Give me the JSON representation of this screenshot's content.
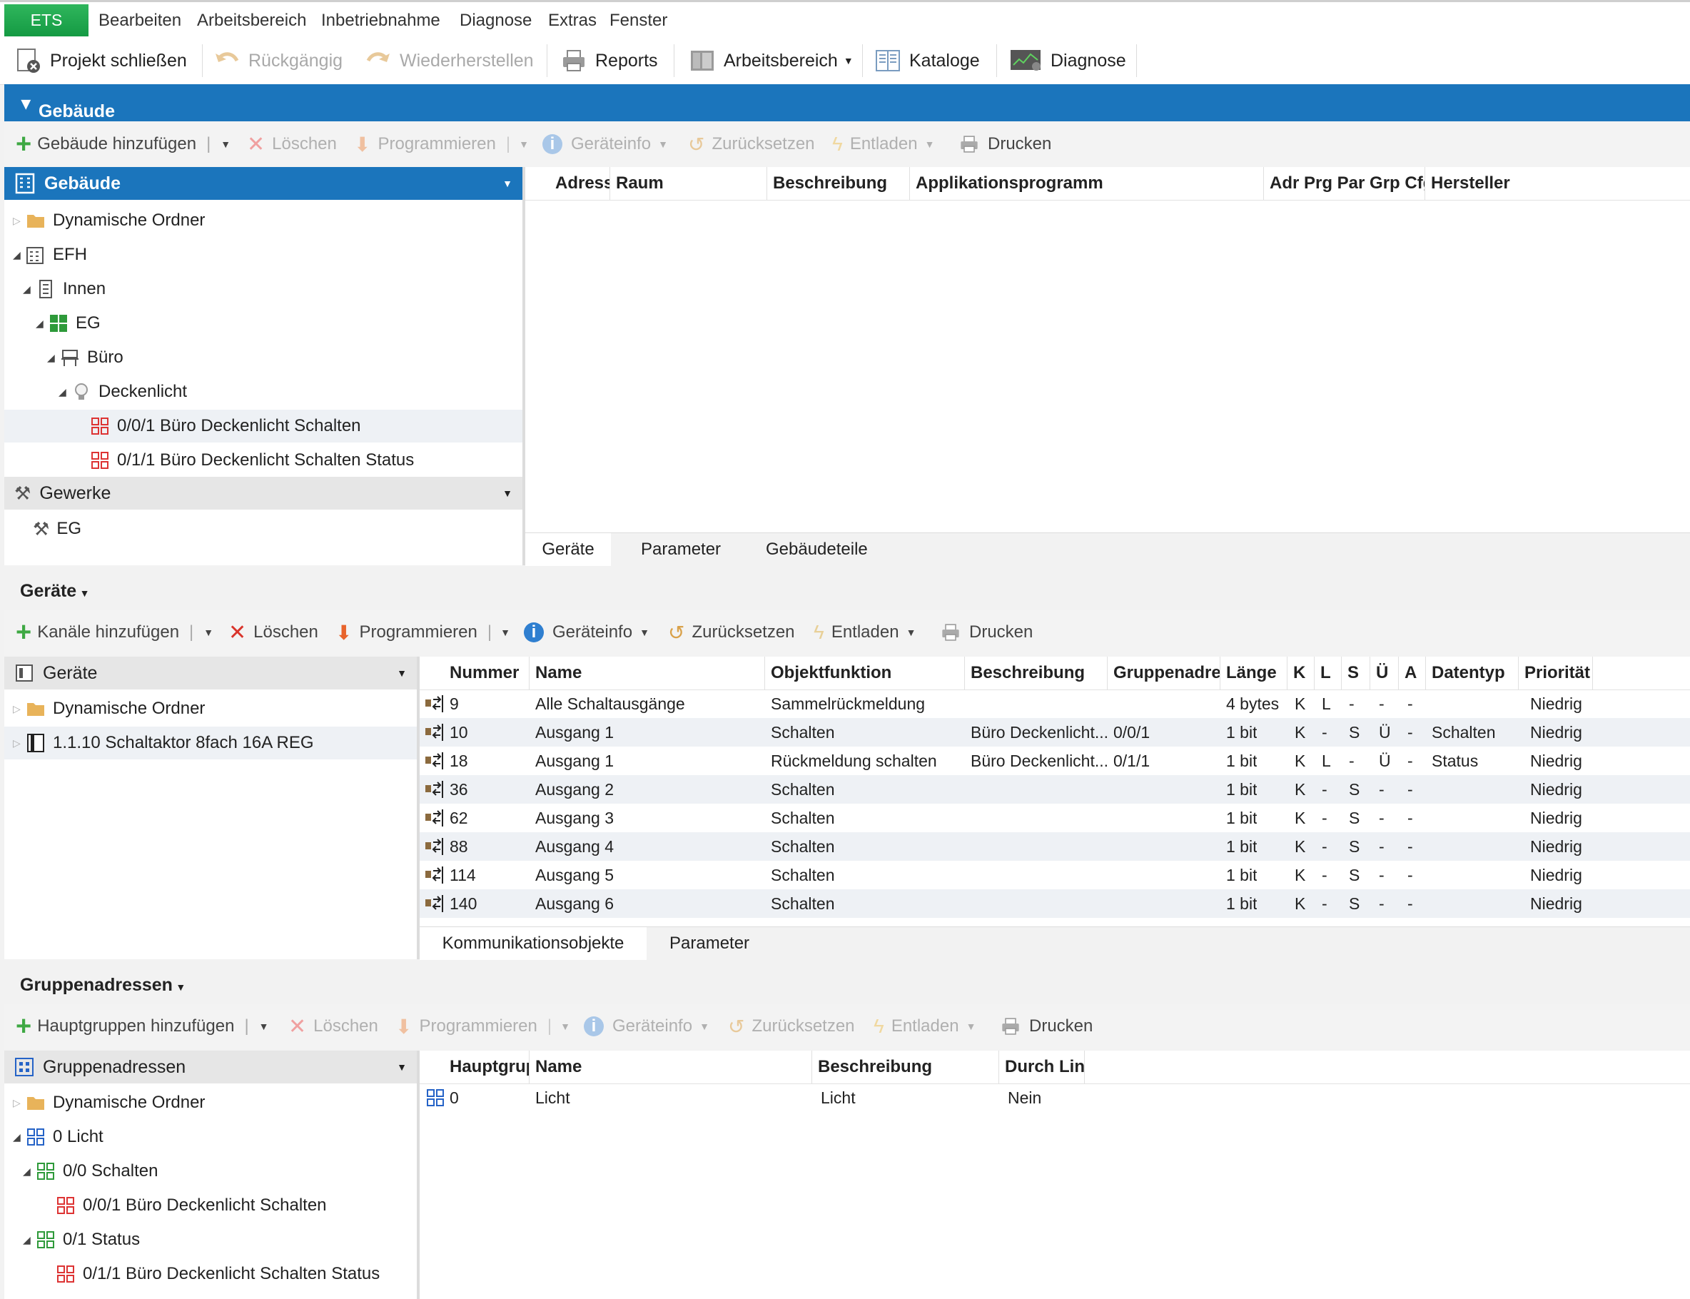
{
  "menu": {
    "ets": "ETS",
    "items": [
      "Bearbeiten",
      "Arbeitsbereich",
      "Inbetriebnahme",
      "Diagnose",
      "Extras",
      "Fenster"
    ]
  },
  "toolbar": {
    "close_project": "Projekt schließen",
    "undo": "Rückgängig",
    "redo": "Wiederherstellen",
    "reports": "Reports",
    "workspace": "Arbeitsbereich",
    "catalogs": "Kataloge",
    "diagnose": "Diagnose"
  },
  "building_bar": {
    "title": "Gebäude"
  },
  "building_toolbar": {
    "add": "Gebäude hinzufügen",
    "delete": "Löschen",
    "program": "Programmieren",
    "info": "Geräteinfo",
    "reset": "Zurücksetzen",
    "unload": "Entladen",
    "print": "Drucken"
  },
  "building_tree": {
    "header": "Gebäude",
    "items": [
      "Dynamische Ordner",
      "EFH",
      "Innen",
      "EG",
      "Büro",
      "Deckenlicht",
      "0/0/1 Büro Deckenlicht Schalten",
      "0/1/1 Büro Deckenlicht Schalten Status"
    ],
    "trades_header": "Gewerke",
    "trades_items": [
      "EG"
    ]
  },
  "building_grid": {
    "columns": [
      "Adresse",
      "Raum",
      "Beschreibung",
      "Applikationsprogramm",
      "Adr Prg Par Grp Cfg",
      "Hersteller"
    ],
    "tabs": [
      "Geräte",
      "Parameter",
      "Gebäudeteile"
    ]
  },
  "devices_section": {
    "title": "Geräte"
  },
  "devices_toolbar": {
    "add": "Kanäle hinzufügen",
    "delete": "Löschen",
    "program": "Programmieren",
    "info": "Geräteinfo",
    "reset": "Zurücksetzen",
    "unload": "Entladen",
    "print": "Drucken"
  },
  "devices_tree": {
    "header": "Geräte",
    "items": [
      "Dynamische Ordner",
      "1.1.10 Schaltaktor 8fach 16A REG"
    ]
  },
  "objects_grid": {
    "columns": [
      "Nummer",
      "Name",
      "Objektfunktion",
      "Beschreibung",
      "Gruppenadresse",
      "Länge",
      "K",
      "L",
      "S",
      "Ü",
      "A",
      "Datentyp",
      "Priorität"
    ],
    "rows": [
      [
        "9",
        "Alle Schaltausgänge",
        "Sammelrückmeldung",
        "",
        "",
        "4 bytes",
        "K",
        "L",
        "-",
        "-",
        "-",
        "",
        "Niedrig"
      ],
      [
        "10",
        "Ausgang 1",
        "Schalten",
        "Büro Deckenlicht...",
        "0/0/1",
        "1 bit",
        "K",
        "-",
        "S",
        "Ü",
        "-",
        "Schalten",
        "Niedrig"
      ],
      [
        "18",
        "Ausgang 1",
        "Rückmeldung schalten",
        "Büro Deckenlicht...",
        "0/1/1",
        "1 bit",
        "K",
        "L",
        "-",
        "Ü",
        "-",
        "Status",
        "Niedrig"
      ],
      [
        "36",
        "Ausgang 2",
        "Schalten",
        "",
        "",
        "1 bit",
        "K",
        "-",
        "S",
        "-",
        "-",
        "",
        "Niedrig"
      ],
      [
        "62",
        "Ausgang 3",
        "Schalten",
        "",
        "",
        "1 bit",
        "K",
        "-",
        "S",
        "-",
        "-",
        "",
        "Niedrig"
      ],
      [
        "88",
        "Ausgang 4",
        "Schalten",
        "",
        "",
        "1 bit",
        "K",
        "-",
        "S",
        "-",
        "-",
        "",
        "Niedrig"
      ],
      [
        "114",
        "Ausgang 5",
        "Schalten",
        "",
        "",
        "1 bit",
        "K",
        "-",
        "S",
        "-",
        "-",
        "",
        "Niedrig"
      ],
      [
        "140",
        "Ausgang 6",
        "Schalten",
        "",
        "",
        "1 bit",
        "K",
        "-",
        "S",
        "-",
        "-",
        "",
        "Niedrig"
      ]
    ],
    "tabs": [
      "Kommunikationsobjekte",
      "Parameter"
    ]
  },
  "ga_section": {
    "title": "Gruppenadressen"
  },
  "ga_toolbar": {
    "add": "Hauptgruppen hinzufügen",
    "delete": "Löschen",
    "program": "Programmieren",
    "info": "Geräteinfo",
    "reset": "Zurücksetzen",
    "unload": "Entladen",
    "print": "Drucken"
  },
  "ga_tree": {
    "header": "Gruppenadressen",
    "items": [
      "Dynamische Ordner",
      "0 Licht",
      "0/0 Schalten",
      "0/0/1 Büro Deckenlicht Schalten",
      "0/1 Status",
      "0/1/1 Büro Deckenlicht Schalten Status"
    ]
  },
  "ga_grid": {
    "columns": [
      "Hauptgruppe",
      "Name",
      "Beschreibung",
      "Durch Linien"
    ],
    "rows": [
      [
        "0",
        "Licht",
        "Licht",
        "Nein"
      ]
    ]
  },
  "colors": {
    "accent": "#1b75bc",
    "ets_green": "#16a34a",
    "selection": "#eef1f5"
  }
}
